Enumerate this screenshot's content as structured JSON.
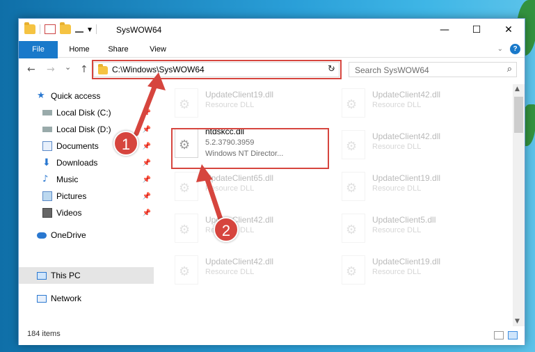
{
  "window": {
    "title": "SysWOW64"
  },
  "ribbon": {
    "tabs": [
      "File",
      "Home",
      "Share",
      "View"
    ]
  },
  "window_buttons": {
    "minimize": "—",
    "maximize": "☐",
    "close": "✕"
  },
  "nav": {
    "back": "←",
    "forward": "→",
    "recent": "⌄",
    "up": "↑"
  },
  "address": {
    "path": "C:\\Windows\\SysWOW64",
    "refresh": "↻"
  },
  "search": {
    "placeholder": "Search SysWOW64",
    "icon": "⌕"
  },
  "sidebar": {
    "items": [
      {
        "label": "Quick access",
        "icon": "star-icon",
        "color": "#2a78d0"
      },
      {
        "label": "Local Disk (C:)",
        "icon": "drive-icon",
        "pinned": true
      },
      {
        "label": "Local Disk (D:)",
        "icon": "drive-icon",
        "pinned": true
      },
      {
        "label": "Documents",
        "icon": "documents-icon",
        "pinned": true
      },
      {
        "label": "Downloads",
        "icon": "downloads-icon",
        "pinned": true
      },
      {
        "label": "Music",
        "icon": "music-icon",
        "pinned": true
      },
      {
        "label": "Pictures",
        "icon": "pictures-icon",
        "pinned": true
      },
      {
        "label": "Videos",
        "icon": "videos-icon",
        "pinned": true
      },
      {
        "label": "OneDrive",
        "icon": "onedrive-icon"
      },
      {
        "label": "This PC",
        "icon": "pc-icon",
        "selected": true
      },
      {
        "label": "Network",
        "icon": "network-icon"
      }
    ]
  },
  "files": {
    "highlighted": {
      "name": "ntdskcc.dll",
      "version": "5.2.3790.3959",
      "description": "Windows NT Director..."
    },
    "faded": [
      {
        "name": "UpdateClient19.dll",
        "type": "Resource DLL"
      },
      {
        "name": "UpdateClient42.dll",
        "type": "Resource DLL"
      },
      {
        "name": "UpdateClient42.dll",
        "type": "Resource DLL"
      },
      {
        "name": "UpdateClient65.dll",
        "type": "Resource DLL"
      },
      {
        "name": "UpdateClient19.dll",
        "type": "Resource DLL"
      },
      {
        "name": "UpdateClient42.dll",
        "type": "Resource DLL"
      },
      {
        "name": "UpdateClient5.dll",
        "type": "Resource DLL"
      },
      {
        "name": "UpdateClient42.dll",
        "type": "Resource DLL"
      },
      {
        "name": "UpdateClient19.dll",
        "type": "Resource DLL"
      }
    ]
  },
  "annotations": {
    "step1": "1",
    "step2": "2",
    "color": "#d6453e"
  },
  "status": {
    "count": "184 items"
  }
}
